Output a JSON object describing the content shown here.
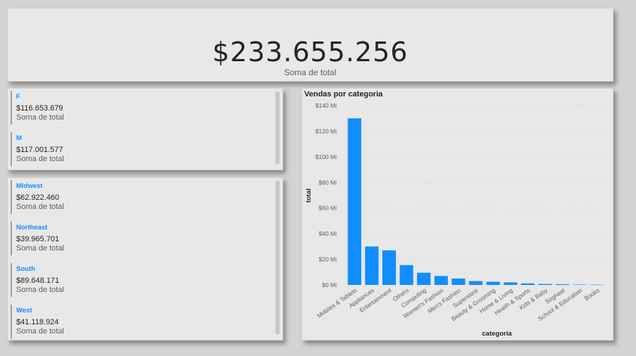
{
  "kpi": {
    "value": "$233.655.256",
    "label": "Soma de total"
  },
  "gender_cards": [
    {
      "category": "F",
      "value": "$116.653.679",
      "label": "Soma de total"
    },
    {
      "category": "M",
      "value": "$117.001.577",
      "label": "Soma de total"
    }
  ],
  "region_cards": [
    {
      "category": "Midwest",
      "value": "$62.922.460",
      "label": "Soma de total"
    },
    {
      "category": "Northeast",
      "value": "$39.965.701",
      "label": "Soma de total"
    },
    {
      "category": "South",
      "value": "$89.648.171",
      "label": "Soma de total"
    },
    {
      "category": "West",
      "value": "$41.118.924",
      "label": "Soma de total"
    }
  ],
  "chart_data": {
    "type": "bar",
    "title": "Vendas por categoria",
    "xlabel": "categoria",
    "ylabel": "total",
    "categories": [
      "Mobiles & Tablets",
      "Appliances",
      "Entertainment",
      "Others",
      "Computing",
      "Women's Fashion",
      "Men's Fashion",
      "Superstore",
      "Beauty & Grooming",
      "Home & Living",
      "Health & Sports",
      "Kids & Baby",
      "Soghaat",
      "School & Education",
      "Books"
    ],
    "values": [
      130,
      30,
      27,
      15.5,
      9.5,
      7,
      5,
      3,
      2.5,
      2,
      1.2,
      0.8,
      0.6,
      0.3,
      0.2
    ],
    "ylim": [
      0,
      140
    ],
    "yticks": [
      "$0 Mi",
      "$20 Mi",
      "$40 Mi",
      "$60 Mi",
      "$80 Mi",
      "$100 Mi",
      "$120 Mi",
      "$140 Mi"
    ],
    "grid": true,
    "bar_color": "#118dff"
  }
}
